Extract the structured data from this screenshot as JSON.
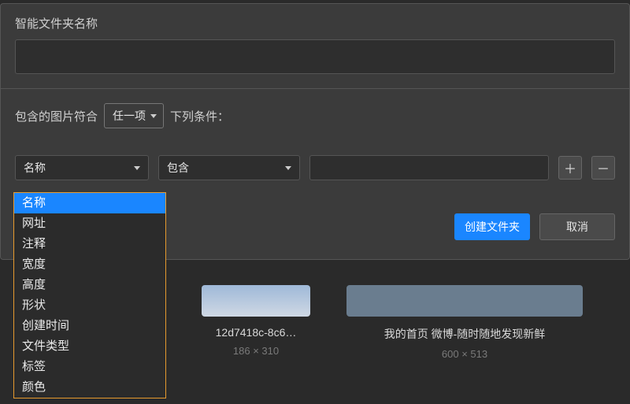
{
  "modal": {
    "title_label": "智能文件夹名称",
    "name_value": "",
    "condition_prefix": "包含的图片符合",
    "condition_suffix": "下列条件：",
    "match_mode_label": "任一项",
    "rule": {
      "field_label": "名称",
      "operator_label": "包含",
      "value": ""
    },
    "add_symbol": "＋",
    "remove_symbol": "－",
    "create_label": "创建文件夹",
    "cancel_label": "取消"
  },
  "field_dropdown": {
    "options": [
      "名称",
      "网址",
      "注释",
      "宽度",
      "高度",
      "形状",
      "创建时间",
      "文件类型",
      "标签",
      "颜色"
    ],
    "selected_index": 0
  },
  "thumbnails": [
    {
      "caption": "12d7418c-8c6…",
      "dimensions": "186 × 310"
    },
    {
      "caption": "我的首页 微博-随时随地发现新鲜",
      "dimensions": "600 × 513"
    }
  ]
}
